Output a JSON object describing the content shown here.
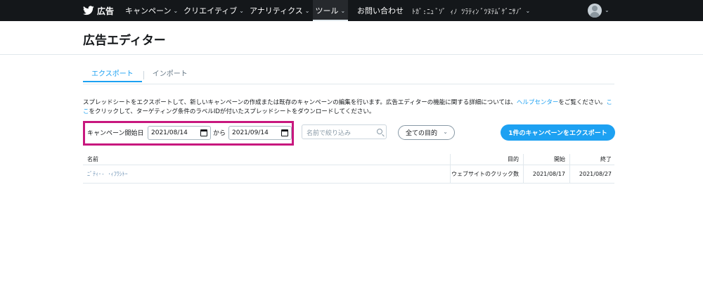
{
  "nav": {
    "brand_label": "広告",
    "items": [
      {
        "label": "キャンペーン"
      },
      {
        "label": "クリエイティブ"
      },
      {
        "label": "アナリティクス"
      },
      {
        "label": "ツール"
      }
    ],
    "contact_label": "お問い合わせ",
    "account_name": "ﾄｶﾞ:ﾆｭ  ﾞｿﾞ ｨﾉ  ﾂﾗﾃｨﾝ ﾞﾂﾇﾃﾑﾞｹﾞﾆｻﾉﾞ"
  },
  "page": {
    "title": "広告エディター"
  },
  "tabs": [
    {
      "label": "エクスポート"
    },
    {
      "label": "インポート"
    }
  ],
  "description": {
    "text_1": "スプレッドシートをエクスポートして、新しいキャンペーンの作成または既存のキャンペーンの編集を行います。広告エディターの機能に関する詳細については、",
    "link_help": "ヘルプセンター",
    "text_2": "をご覧ください。",
    "link_here": "ここ",
    "text_3": "をクリックして、ターゲティング条件のラベルIDが付いたスプレッドシートをダウンロードしてください。"
  },
  "filters": {
    "date_label": "キャンペーン開始日",
    "date_from": "2021/08/14",
    "connector": "から",
    "date_to": "2021/09/14",
    "search_placeholder": "名前で絞り込み",
    "objective_select": "全ての目的",
    "export_button": "1件のキャンペーンをエクスポート"
  },
  "table": {
    "headers": {
      "name": "名前",
      "objective": "目的",
      "start": "開始",
      "end": "終了"
    },
    "rows": [
      {
        "name": "ﾆﾞﾃｨ･-  ･ｨﾌﾜｼﾄｰ",
        "objective": "ウェブサイトのクリック数",
        "start": "2021/08/17",
        "end": "2021/08/27"
      }
    ]
  },
  "colors": {
    "nav_bg": "#14171a",
    "accent": "#1da1f2",
    "highlight": "#c8177e"
  }
}
